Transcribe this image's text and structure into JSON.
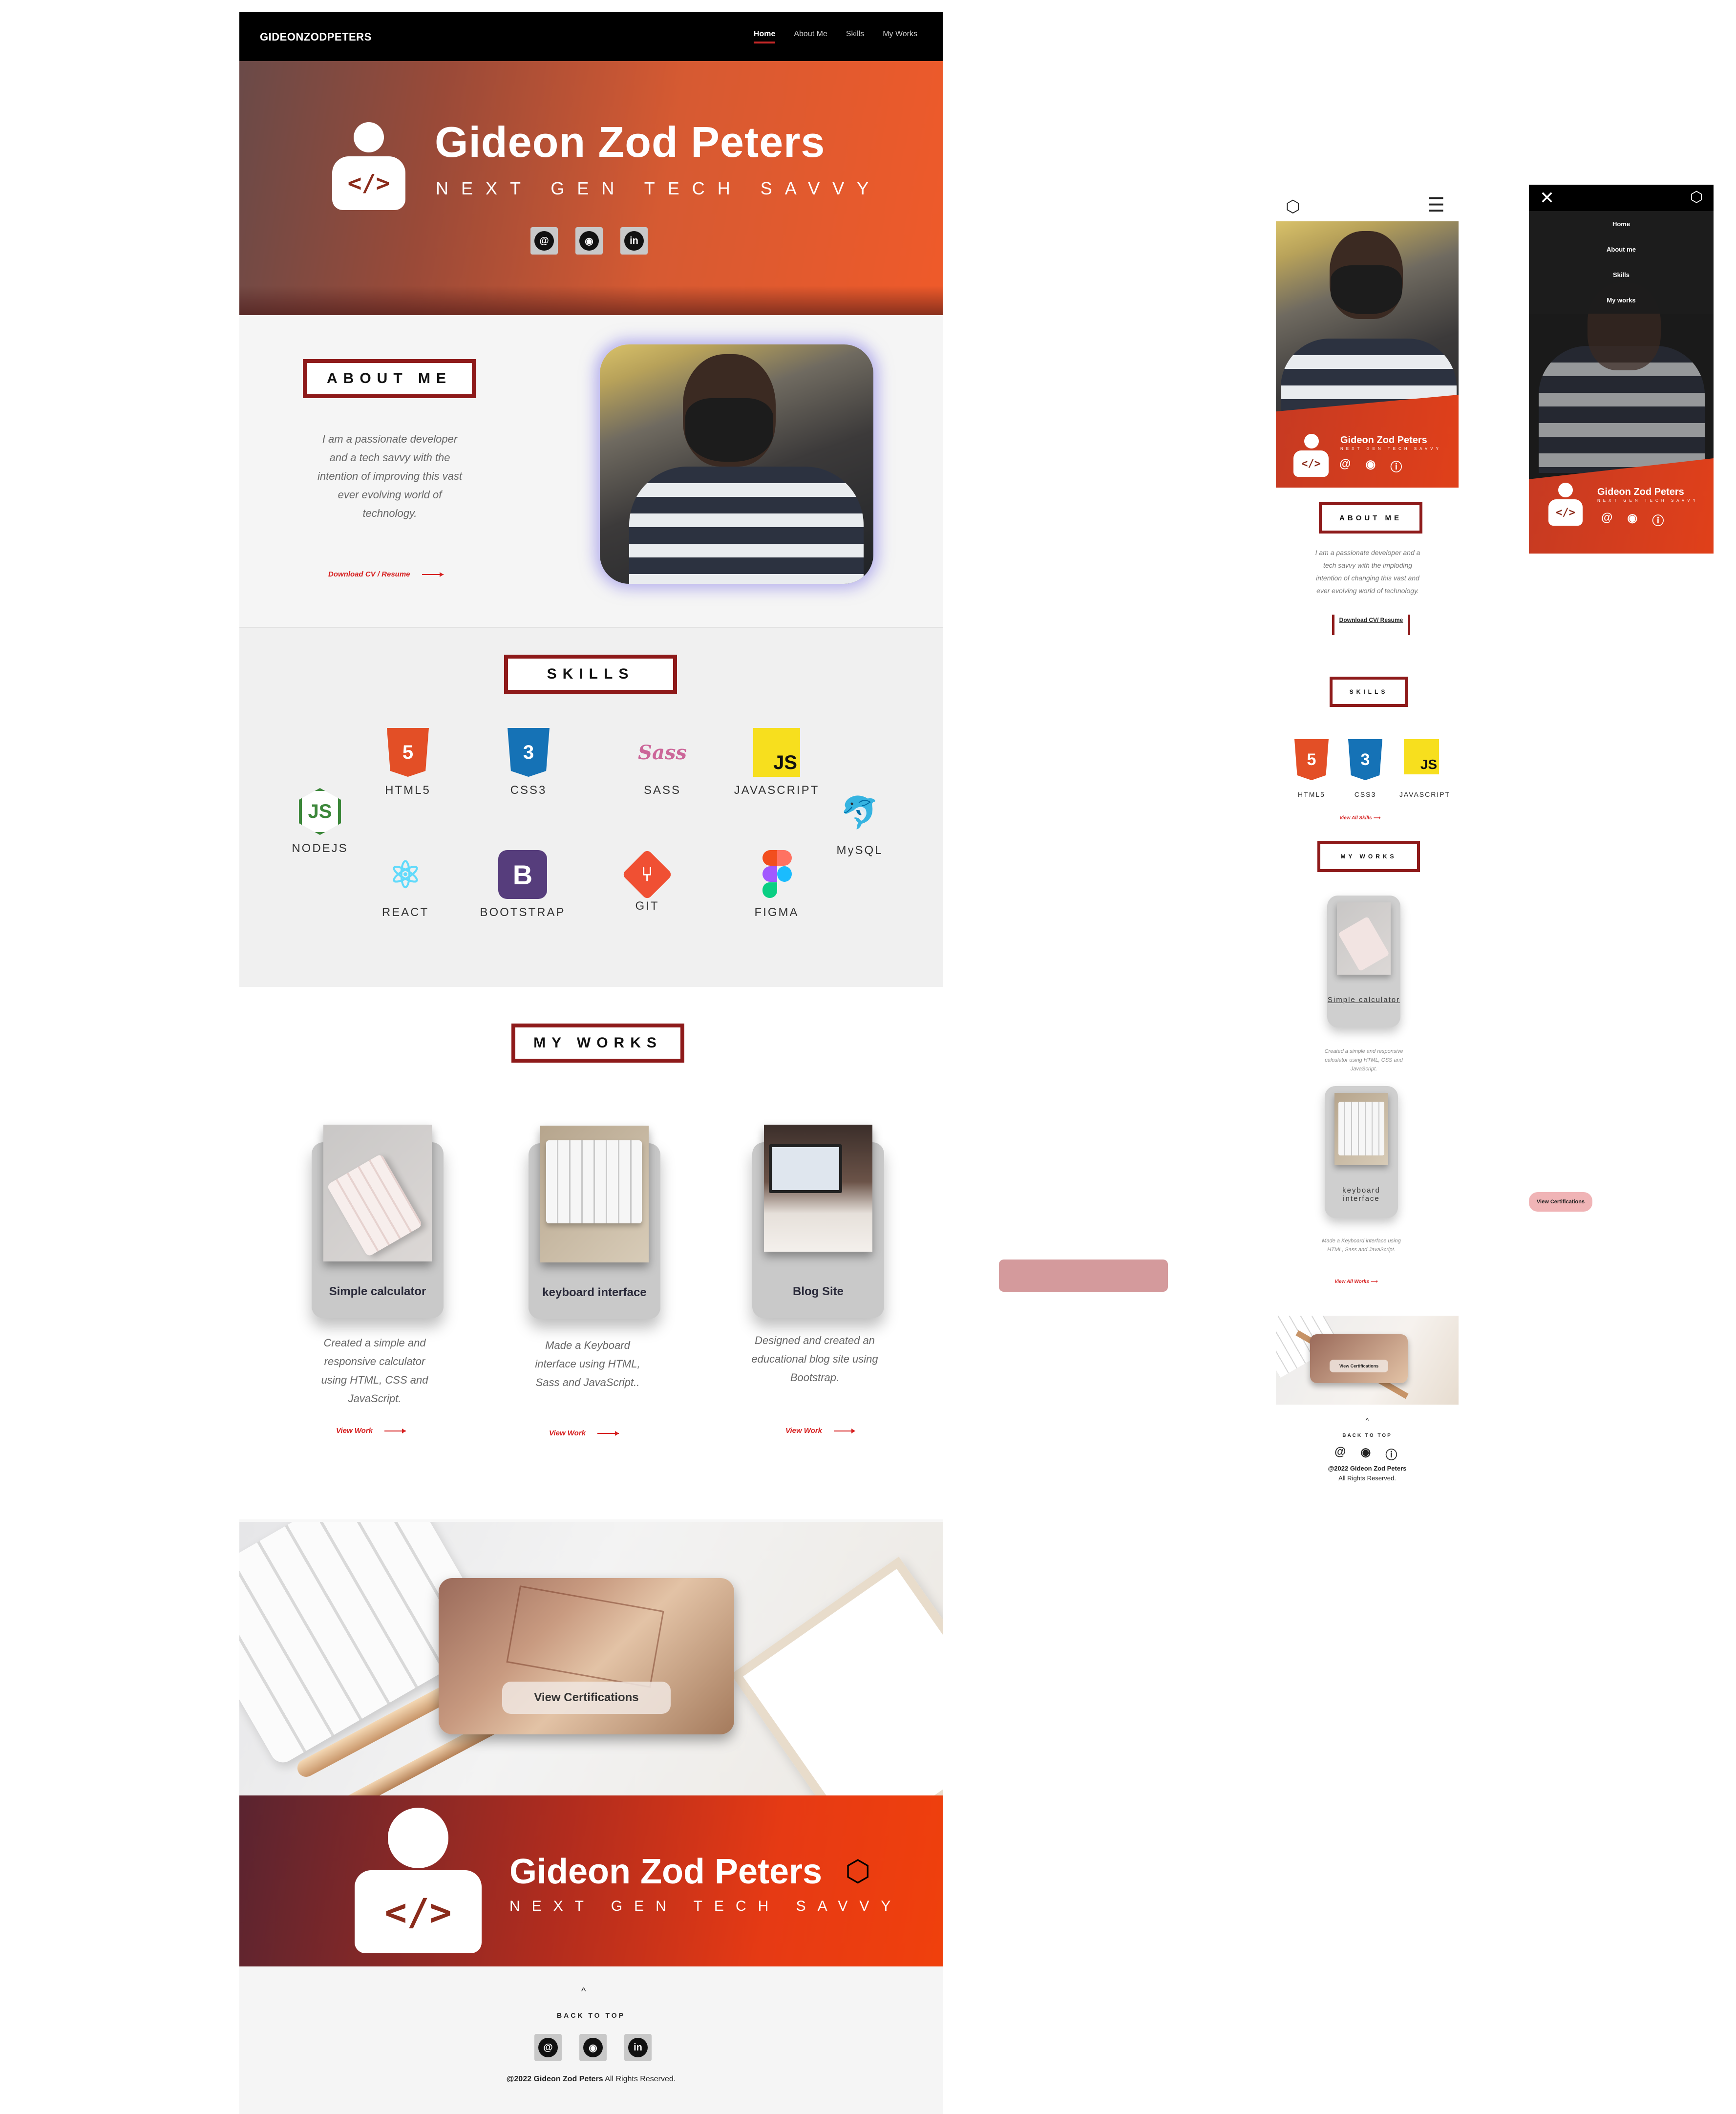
{
  "desktop": {
    "nav": {
      "brand": "GIDEONZODPETERS",
      "links": [
        "Home",
        "About Me",
        "Skills",
        "My Works"
      ]
    },
    "hero": {
      "name": "Gideon Zod Peters",
      "tagline": "NEXT GEN TECH SAVVY",
      "avatar_glyph": "</>",
      "socials": [
        "@",
        "github-icon",
        "in"
      ]
    },
    "about": {
      "heading": "ABOUT ME",
      "text": "I am a passionate developer and a tech savvy with the intention of improving this vast ever evolving world of technology.",
      "cv_link": "Download CV / Resume"
    },
    "skills": {
      "heading": "SKILLS",
      "items": [
        {
          "label": "HTML5",
          "icon": "html5-icon",
          "color": "#e34f26",
          "glyph": "5"
        },
        {
          "label": "CSS3",
          "icon": "css3-icon",
          "color": "#1572b6",
          "glyph": "3"
        },
        {
          "label": "SASS",
          "icon": "sass-icon",
          "color": "#cc6699",
          "glyph": "Sass"
        },
        {
          "label": "JAVASCRIPT",
          "icon": "javascript-icon",
          "color": "#f7df1e",
          "glyph": "JS"
        },
        {
          "label": "NODEJS",
          "icon": "nodejs-icon",
          "color": "#3c873a",
          "glyph": "JS"
        },
        {
          "label": "MySQL",
          "icon": "mysql-dolphin-icon",
          "color": "#00758f",
          "glyph": "🐬"
        },
        {
          "label": "REACT",
          "icon": "react-icon",
          "color": "#61dafb",
          "glyph": "⚛"
        },
        {
          "label": "BOOTSTRAP",
          "icon": "bootstrap-icon",
          "color": "#563d7c",
          "glyph": "B"
        },
        {
          "label": "GIT",
          "icon": "git-icon",
          "color": "#f05033",
          "glyph": "⑂"
        },
        {
          "label": "FIGMA",
          "icon": "figma-icon",
          "color": "#a259ff",
          "glyph": ""
        }
      ]
    },
    "works": {
      "heading": "MY WORKS",
      "items": [
        {
          "title": "Simple calculator",
          "desc": "Created a simple and responsive calculator using HTML, CSS and JavaScript.",
          "link": "View Work"
        },
        {
          "title": "keyboard interface",
          "desc": "Made a Keyboard interface using HTML, Sass and JavaScript..",
          "link": "View Work"
        },
        {
          "title": "Blog Site",
          "desc": "Designed and created an educational blog site using Bootstrap.",
          "link": "View Work"
        }
      ]
    },
    "cert": {
      "button": "View Certifications"
    },
    "footband": {
      "name": "Gideon Zod Peters",
      "tagline": "NEXT GEN TECH SAVVY"
    },
    "footer": {
      "up_arrow": "^",
      "back_to_top": "BACK TO TOP",
      "copyright_bold": "@2022 Gideon Zod Peters",
      "copyright_rest": " All Rights Reserved."
    }
  },
  "mobile": {
    "hero": {
      "name": "Gideon Zod Peters",
      "tagline": "NEXT GEN TECH SAVVY"
    },
    "about": {
      "heading": "ABOUT ME",
      "text": "I am a passionate developer and a tech savvy with the imploding intention of changing this vast and ever evolving world of technology.",
      "cv_link": "Download CV/ Resume"
    },
    "skills": {
      "heading": "SKILLS",
      "items": [
        "HTML5",
        "CSS3",
        "JAVASCRIPT"
      ],
      "view_all": "View All Skills"
    },
    "works": {
      "heading": "MY WORKS",
      "items": [
        {
          "title": "Simple calculator",
          "desc": "Created a simple and responsive calculator using HTML, CSS and JavaScript."
        },
        {
          "title": "keyboard interface",
          "desc": "Made a Keyboard interface using HTML, Sass and JavaScript."
        }
      ],
      "view_all": "View All Works"
    },
    "cert": {
      "button": "View Certifications"
    },
    "footer": {
      "up_arrow": "^",
      "back_to_top": "BACK TO TOP",
      "copyright_line1": "@2022 Gideon Zod Peters",
      "copyright_line2": "All Rights Reserved."
    }
  },
  "mobile_menu": {
    "items": [
      "Home",
      "About me",
      "Skills",
      "My works"
    ],
    "name": "Gideon Zod Peters",
    "tagline": "NEXT GEN TECH SAVVY"
  },
  "side_button": "View Certifications",
  "colors": {
    "accent": "#8e1a1a",
    "link": "#d62020",
    "hero_start": "#6a4a48",
    "hero_end": "#ef5a2a"
  }
}
